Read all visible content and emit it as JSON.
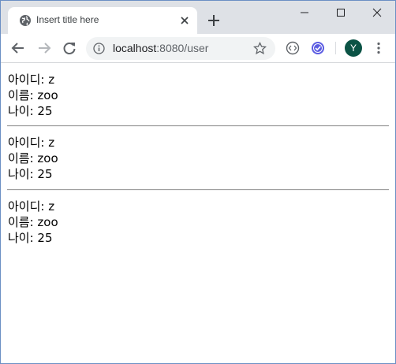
{
  "browser": {
    "tab_title": "Insert title here",
    "url_host": "localhost",
    "url_rest": ":8080/user",
    "avatar_letter": "Y"
  },
  "icons": {
    "favicon": "globe-icon",
    "tab_close": "close-icon",
    "new_tab": "plus-icon",
    "minimize": "minimize-icon",
    "maximize": "maximize-icon",
    "window_close": "close-icon",
    "back": "arrow-left-icon",
    "forward": "arrow-right-icon",
    "reload": "reload-icon",
    "site_info": "info-icon",
    "bookmark": "star-icon",
    "extension_1": "code-icon",
    "extension_2": "check-badge-icon",
    "menu": "kebab-menu-icon"
  },
  "records": [
    {
      "id_label": "아이디: z",
      "name_label": "이름: zoo",
      "age_label": "나이: 25"
    },
    {
      "id_label": "아이디: z",
      "name_label": "이름: zoo",
      "age_label": "나이: 25"
    },
    {
      "id_label": "아이디: z",
      "name_label": "이름: zoo",
      "age_label": "나이: 25"
    }
  ],
  "colors": {
    "tabstrip": "#dee1e6",
    "omnibox": "#f1f3f4",
    "avatar": "#0b5345",
    "extension_badge": "#5b5ce2"
  }
}
